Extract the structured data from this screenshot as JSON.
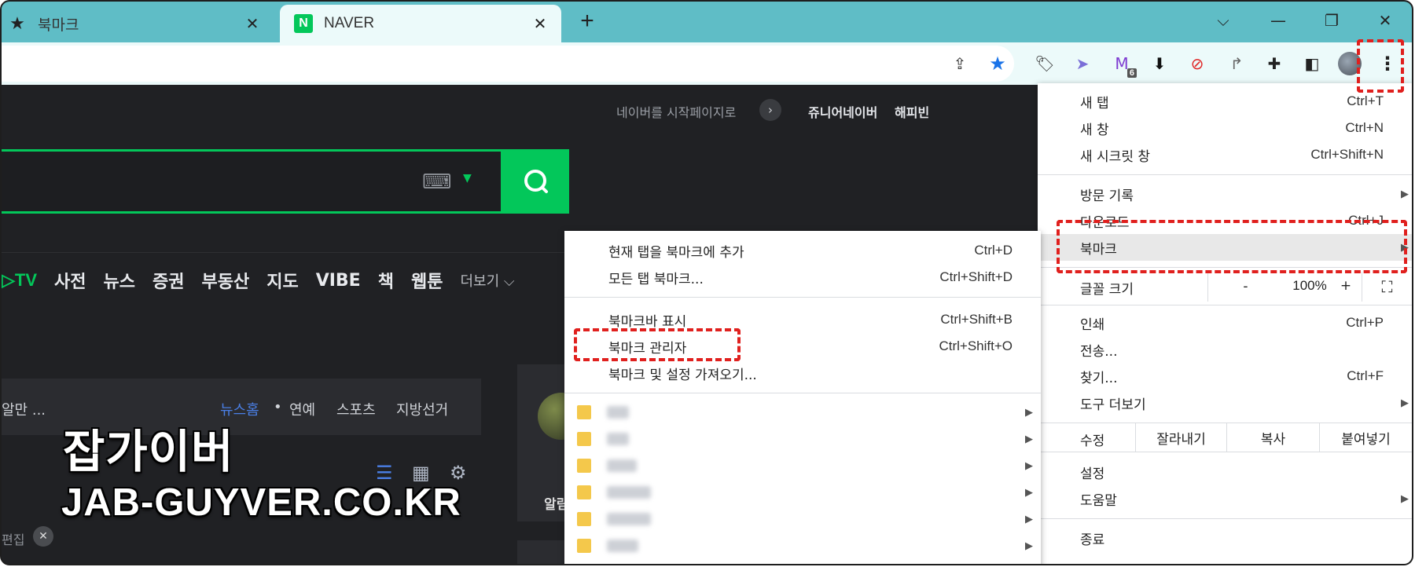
{
  "tabs": [
    {
      "title": "북마크",
      "icon": "star-icon"
    },
    {
      "title": "NAVER",
      "icon": "naver-n-icon",
      "icon_text": "N"
    }
  ],
  "window": {
    "minimize": "—",
    "restore": "❐",
    "close": "✕",
    "dropdown": "⌵"
  },
  "page": {
    "top_links": {
      "set_start": "네이버를 시작페이지로",
      "junior": "쥬니어네이버",
      "happybean": "해피빈"
    },
    "nav": {
      "tv": "▷TV",
      "items": [
        "사전",
        "뉴스",
        "증권",
        "부동산",
        "지도",
        "VIBE",
        "책",
        "웹툰"
      ],
      "more": "더보기 ⌵"
    },
    "news_bar": {
      "left": "알만 ...",
      "news_home": "뉴스홈",
      "dot": "•",
      "ent": "연예",
      "sports": "스포츠",
      "election": "지방선거"
    },
    "right_panel_text": "알림",
    "edit_label": "편집",
    "watermark": {
      "line1": "잡가이버",
      "line2": "JAB-GUYVER.CO.KR"
    }
  },
  "menu": {
    "new_tab": {
      "label": "새 탭",
      "shortcut": "Ctrl+T"
    },
    "new_window": {
      "label": "새 창",
      "shortcut": "Ctrl+N"
    },
    "incognito": {
      "label": "새 시크릿 창",
      "shortcut": "Ctrl+Shift+N"
    },
    "history": {
      "label": "방문 기록"
    },
    "downloads": {
      "label": "다운로드",
      "shortcut": "Ctrl+J"
    },
    "bookmarks": {
      "label": "북마크"
    },
    "zoom": {
      "label": "글꼴 크기",
      "minus": "-",
      "value": "100%",
      "plus": "+"
    },
    "print": {
      "label": "인쇄",
      "shortcut": "Ctrl+P"
    },
    "cast": {
      "label": "전송..."
    },
    "find": {
      "label": "찾기...",
      "shortcut": "Ctrl+F"
    },
    "more_tools": {
      "label": "도구 더보기"
    },
    "edit": {
      "label": "수정",
      "cut": "잘라내기",
      "copy": "복사",
      "paste": "붙여넣기"
    },
    "settings": {
      "label": "설정"
    },
    "help": {
      "label": "도움말"
    },
    "exit": {
      "label": "종료"
    }
  },
  "bookmark_submenu": {
    "add_current": {
      "label": "현재 탭을 북마크에 추가",
      "shortcut": "Ctrl+D"
    },
    "bookmark_all": {
      "label": "모든 탭 북마크...",
      "shortcut": "Ctrl+Shift+D"
    },
    "show_bar": {
      "label": "북마크바 표시",
      "shortcut": "Ctrl+Shift+B"
    },
    "manager": {
      "label": "북마크 관리자",
      "shortcut": "Ctrl+Shift+O"
    },
    "import": {
      "label": "북마크 및 설정 가져오기..."
    }
  },
  "colors": {
    "naver_green": "#03c75a",
    "tab_strip": "#5fbdc6",
    "highlight_red": "#e0201e"
  }
}
